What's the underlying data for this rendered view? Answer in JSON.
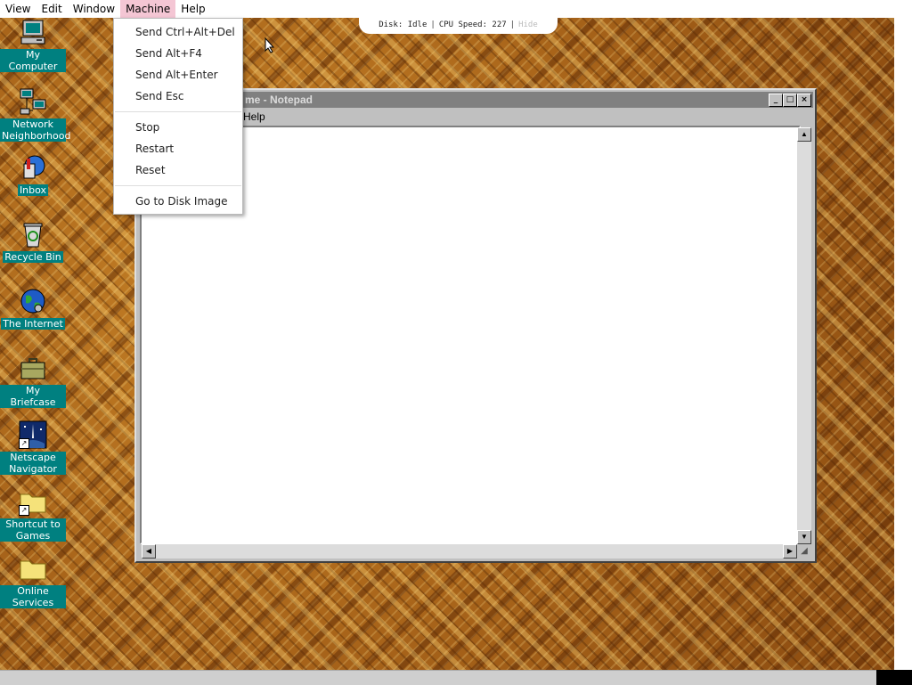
{
  "host_menubar": {
    "items": [
      {
        "label": "View"
      },
      {
        "label": "Edit"
      },
      {
        "label": "Window"
      },
      {
        "label": "Machine"
      },
      {
        "label": "Help"
      }
    ]
  },
  "status": {
    "disk": "Disk: Idle",
    "cpu": "CPU Speed: 227",
    "hide": "Hide"
  },
  "machine_menu": {
    "items": [
      "Send Ctrl+Alt+Del",
      "Send Alt+F4",
      "Send Alt+Enter",
      "Send Esc",
      "Stop",
      "Restart",
      "Reset",
      "Go to Disk Image"
    ]
  },
  "desktop_icons": [
    {
      "label": "My Computer"
    },
    {
      "label": "Network Neighborhood"
    },
    {
      "label": "Inbox"
    },
    {
      "label": "Recycle Bin"
    },
    {
      "label": "The Internet"
    },
    {
      "label": "My Briefcase"
    },
    {
      "label": "Netscape Navigator"
    },
    {
      "label": "Shortcut to Games"
    },
    {
      "label": "Online Services"
    }
  ],
  "notepad": {
    "title_visible": "me - Notepad",
    "menu_help": "Help",
    "buttons": {
      "minimize": "_",
      "maximize": "□",
      "close": "×"
    }
  },
  "colors": {
    "desktop_wallpaper": "#9c5a14",
    "icon_label_bg": "#008080",
    "active_menu": "#f4c6d4",
    "title_inactive": "#808080"
  }
}
